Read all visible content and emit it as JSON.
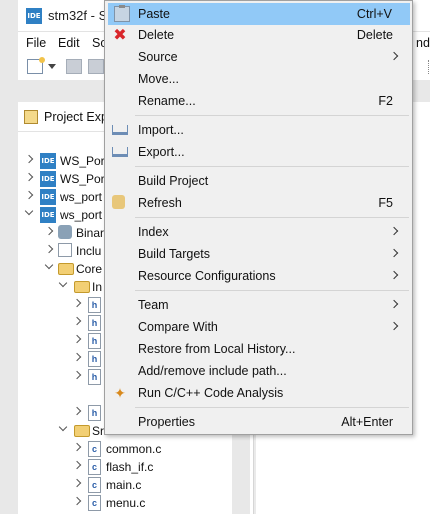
{
  "window": {
    "title": "stm32f - S",
    "app_logo": "IDE"
  },
  "menubar": {
    "file": "File",
    "edit": "Edit",
    "source_partial": "So",
    "window_partial": "ndo"
  },
  "explorer": {
    "title": "Project Exp",
    "tree": [
      {
        "label": "WS_Port",
        "icon": "ide-project-icon",
        "expanded": false
      },
      {
        "label": "WS_Port",
        "icon": "ide-project-icon",
        "expanded": false
      },
      {
        "label": "ws_port",
        "icon": "ide-project-icon",
        "expanded": false
      },
      {
        "label": "ws_port",
        "icon": "ide-project-icon",
        "expanded": true
      },
      {
        "label": "Binar",
        "icon": "binaries-icon",
        "expanded": false
      },
      {
        "label": "Inclu",
        "icon": "includes-icon",
        "expanded": false
      },
      {
        "label": "Core",
        "icon": "folder-icon",
        "expanded": true
      },
      {
        "label": "In",
        "icon": "folder-icon",
        "expanded": true
      },
      {
        "label": "h",
        "icon": "header-file-icon"
      },
      {
        "label": "h",
        "icon": "header-file-icon"
      },
      {
        "label": "h",
        "icon": "header-file-icon"
      },
      {
        "label": "h",
        "icon": "header-file-icon"
      },
      {
        "label": "h",
        "icon": "header-file-icon"
      },
      {
        "label": "h",
        "icon": "header-file-icon"
      },
      {
        "label": "Sr",
        "icon": "folder-icon",
        "expanded": true
      },
      {
        "label": "common.c",
        "icon": "c-file-icon"
      },
      {
        "label": "flash_if.c",
        "icon": "c-file-icon"
      },
      {
        "label": "main.c",
        "icon": "c-file-icon"
      },
      {
        "label": "menu.c",
        "icon": "c-file-icon"
      }
    ]
  },
  "context_menu": {
    "items": [
      {
        "label": "Paste",
        "shortcut": "Ctrl+V",
        "icon": "paste-icon",
        "highlighted": true
      },
      {
        "label": "Delete",
        "shortcut": "Delete",
        "icon": "delete-icon"
      },
      {
        "label": "Source",
        "submenu": true
      },
      {
        "label": "Move..."
      },
      {
        "label": "Rename...",
        "shortcut": "F2"
      },
      {
        "separator": true
      },
      {
        "label": "Import...",
        "icon": "import-icon"
      },
      {
        "label": "Export...",
        "icon": "export-icon"
      },
      {
        "separator": true
      },
      {
        "label": "Build Project"
      },
      {
        "label": "Refresh",
        "shortcut": "F5",
        "icon": "refresh-icon"
      },
      {
        "separator": true
      },
      {
        "label": "Index",
        "submenu": true
      },
      {
        "label": "Build Targets",
        "submenu": true
      },
      {
        "label": "Resource Configurations",
        "submenu": true
      },
      {
        "separator": true
      },
      {
        "label": "Team",
        "submenu": true
      },
      {
        "label": "Compare With",
        "submenu": true
      },
      {
        "label": "Restore from Local History..."
      },
      {
        "label": "Add/remove include path..."
      },
      {
        "label": "Run C/C++ Code Analysis",
        "icon": "code-analysis-icon"
      },
      {
        "separator": true
      },
      {
        "label": "Properties",
        "shortcut": "Alt+Enter"
      }
    ]
  },
  "colors": {
    "menu_highlight": "#91c9f7",
    "menu_background": "#f0f0f0",
    "ide_blue": "#2f80c4"
  }
}
